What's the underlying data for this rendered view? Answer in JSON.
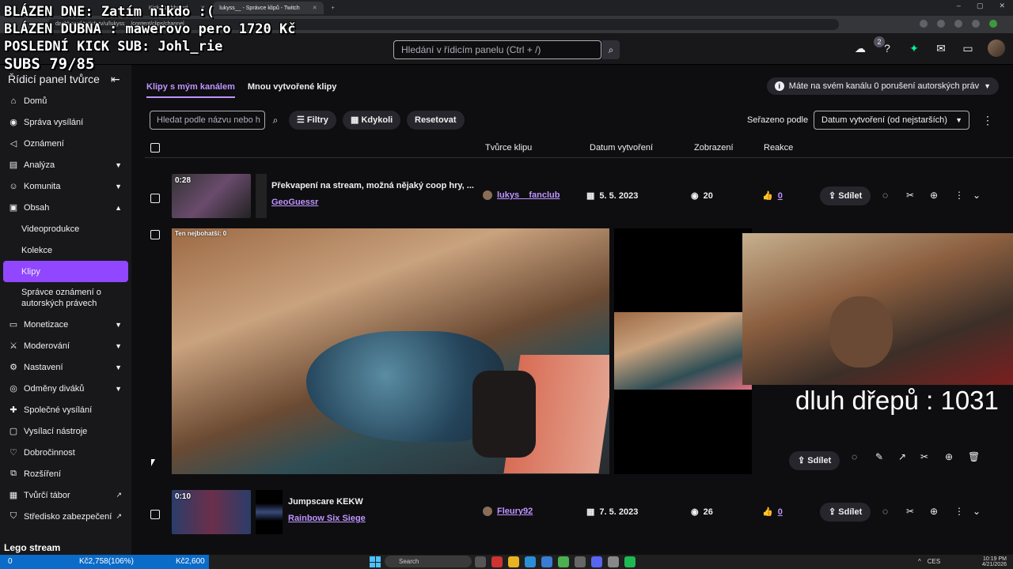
{
  "browser": {
    "tabs": [
      {
        "label": "Kick Dashboard",
        "active": false
      },
      {
        "label": "lukyss__ - Správce klipů - Twitch",
        "active": true
      }
    ],
    "url": "dashboard.twitch.tv/u/lukyss__/content/clips/channel"
  },
  "overlay": {
    "line1": "BLÁZEN DNE: Zatím nikdo :(",
    "line2": "BLÁZEN DUBNA : mawerovo pero 1720 Kč",
    "line3": "POSLEDNÍ KICK SUB: Johl_rie",
    "line4": "SUBS 79/85"
  },
  "topbar": {
    "search_placeholder": "Hledání v řídicím panelu (Ctrl + /)",
    "notification_count": "2"
  },
  "sidebar": {
    "title": "Řídicí panel tvůrce",
    "items": [
      {
        "label": "Domů",
        "icon": "home-icon",
        "chevron": ""
      },
      {
        "label": "Správa vysílání",
        "icon": "broadcast-icon",
        "chevron": ""
      },
      {
        "label": "Oznámení",
        "icon": "megaphone-icon",
        "chevron": ""
      },
      {
        "label": "Analýza",
        "icon": "analytics-icon",
        "chevron": "down"
      },
      {
        "label": "Komunita",
        "icon": "community-icon",
        "chevron": "down"
      },
      {
        "label": "Obsah",
        "icon": "content-icon",
        "chevron": "up"
      }
    ],
    "sub_items": [
      {
        "label": "Videoprodukce"
      },
      {
        "label": "Kolekce"
      },
      {
        "label": "Klipy",
        "active": true
      },
      {
        "label": "Správce oznámení o autorských právech"
      }
    ],
    "items2": [
      {
        "label": "Monetizace",
        "icon": "money-icon",
        "chevron": "down"
      },
      {
        "label": "Moderování",
        "icon": "sword-icon",
        "chevron": "down"
      },
      {
        "label": "Nastavení",
        "icon": "gear-icon",
        "chevron": "down"
      },
      {
        "label": "Odměny diváků",
        "icon": "rewards-icon",
        "chevron": "down"
      },
      {
        "label": "Společné vysílání",
        "icon": "collab-icon",
        "chevron": ""
      },
      {
        "label": "Vysílací nástroje",
        "icon": "tools-icon",
        "chevron": ""
      },
      {
        "label": "Dobročinnost",
        "icon": "charity-icon",
        "chevron": ""
      },
      {
        "label": "Rozšíření",
        "icon": "extension-icon",
        "chevron": ""
      },
      {
        "label": "Tvůrčí tábor",
        "icon": "camp-icon",
        "chevron": "external"
      },
      {
        "label": "Středisko zabezpečení",
        "icon": "shield-icon",
        "chevron": "external"
      }
    ],
    "footer": "Lego stream"
  },
  "main": {
    "tab_my_channel": "Klipy s mým kanálem",
    "tab_created_by_me": "Mnou vytvořené klipy",
    "copyright_notice": "Máte na svém kanálu 0 porušení autorských práv",
    "clip_search_placeholder": "Hledat podle názvu nebo h",
    "filters_label": "Filtry",
    "when_label": "Kdykoli",
    "reset_label": "Resetovat",
    "sort_label": "Seřazeno podle",
    "sort_value": "Datum vytvoření (od nejstarších)",
    "columns": {
      "creator": "Tvůrce klipu",
      "date": "Datum vytvoření",
      "views": "Zobrazení",
      "reactions": "Reakce"
    },
    "share_label": "Sdílet",
    "clips": [
      {
        "duration": "0:28",
        "title": "Překvapení na stream, možná nějaký coop hry, ...",
        "game": "GeoGuessr",
        "creator": "lukys__fanclub",
        "date": "5. 5. 2023",
        "views": "20",
        "likes": "0"
      },
      {
        "duration": "0:10",
        "title": "Jumpscare KEKW",
        "game": "Rainbow Six Siege",
        "creator": "Fleury92",
        "date": "7. 5. 2023",
        "views": "26",
        "likes": "0"
      }
    ],
    "expanded_clip": {
      "video_label": "Ten nejbohatší: 0",
      "overlay_text": "dluh dřepů : 1031"
    }
  },
  "statusbar": {
    "left_value1": "0",
    "left_value2": "Kč2,758(106%)",
    "left_value3": "Kč2,600",
    "taskbar_search": "Search",
    "time": "10:19 PM",
    "date": "4/21/2026",
    "lang": "CES"
  }
}
